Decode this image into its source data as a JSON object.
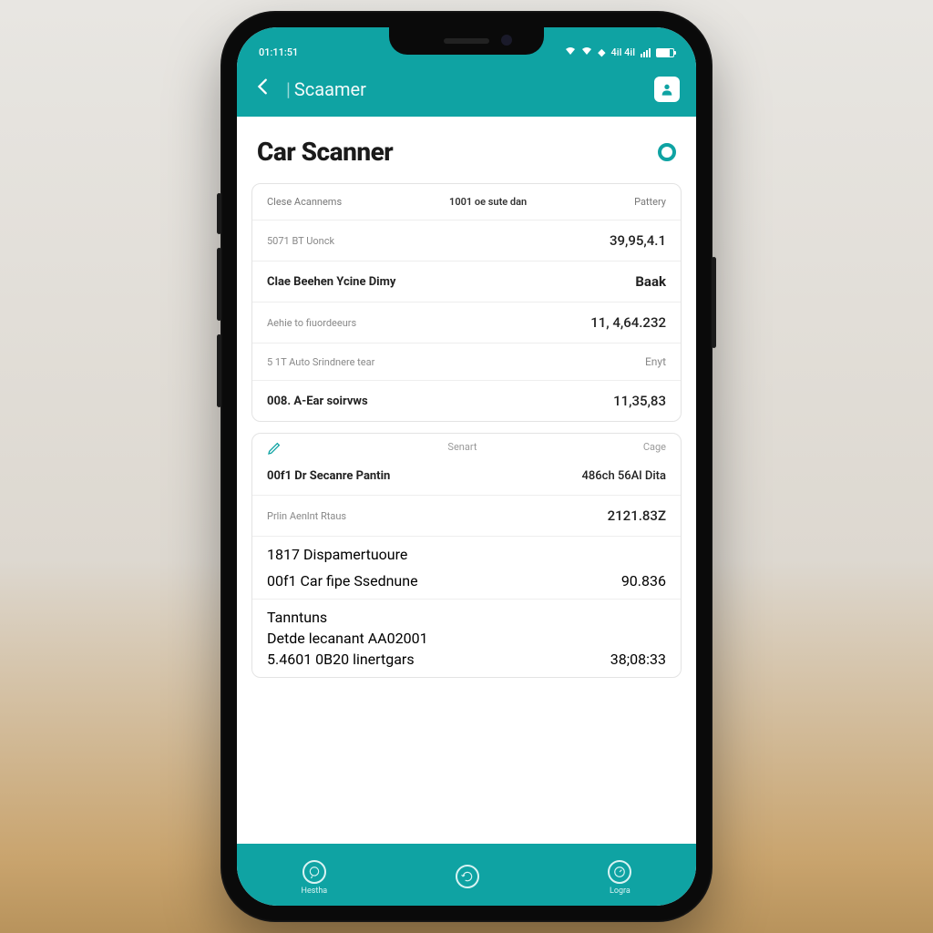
{
  "status": {
    "time": "01:11:51",
    "right_text": "4il 4il"
  },
  "appbar": {
    "title": "Scaamer"
  },
  "page": {
    "title": "Car Scanner"
  },
  "card1": {
    "hdr_left": "Clese Acannems",
    "hdr_mid": "1001 oe sute dan",
    "hdr_right": "Pattery",
    "r1_label": "5071 BT Uonck",
    "r1_value": "39,95,4.1",
    "r2_label": "Clae Beehen Ycine Dimy",
    "r2_value": "Baak",
    "r3_label": "Aehie to fiuordeeurs",
    "r3_value": "11, 4,64.232",
    "r4_label": "5 1T Auto Srindnere tear",
    "r4_value": "Enyt",
    "r5_label": "008. A-Ear soirvws",
    "r5_value": "11,35,83"
  },
  "card2": {
    "mh_mid": "Senart",
    "mh_right": "Cage",
    "r1_label": "00f1 Dr Secanre Pantin",
    "r1_value": "486ch 56Al Dita",
    "r2_label": "Prlin Aenlnt Rtaus",
    "r2_value": "2121.83Z",
    "r3_label": "1817 Dispamertuoure",
    "r4_label": "00f1 Car fipe Ssednune",
    "r4_value": "90.836",
    "r5_label": "Tanntuns",
    "r6_label": "Detde lecanant AA02001",
    "r7_label": "5.4601 0B20 linertgars",
    "r7_value": "38;08:33"
  },
  "nav": {
    "a": "Hestha",
    "b": "",
    "c": "Logra"
  }
}
